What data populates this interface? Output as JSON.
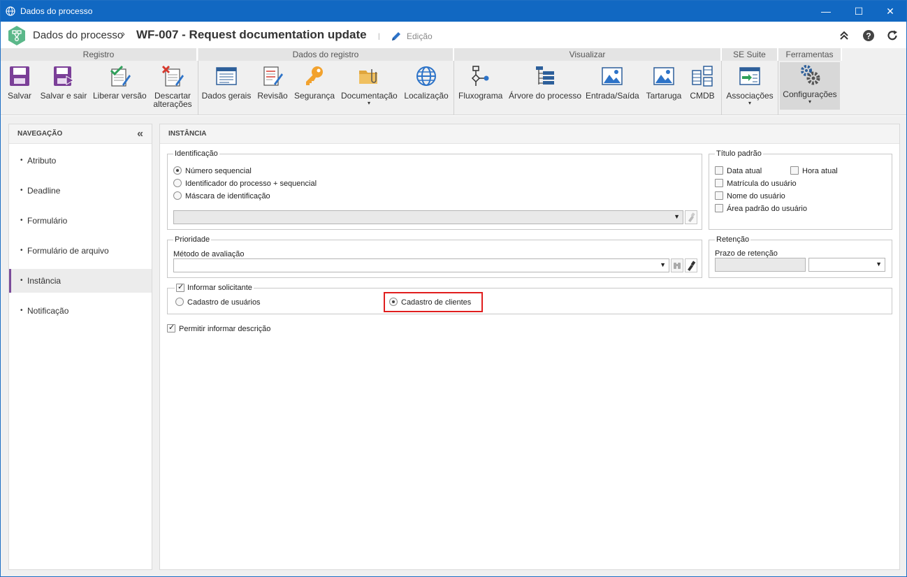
{
  "window": {
    "title": "Dados do processo",
    "minimize": "—",
    "maximize": "☐",
    "close": "✕"
  },
  "header": {
    "breadcrumb_root": "Dados do processo",
    "separator": "›",
    "breadcrumb_current": "WF-007 - Request documentation update",
    "divider": "|",
    "mode_label": "Edição"
  },
  "ribbon": {
    "groups": [
      {
        "title": "Registro",
        "buttons": [
          {
            "label": "Salvar",
            "icon": "save-icon"
          },
          {
            "label": "Salvar e sair",
            "icon": "save-exit-icon"
          },
          {
            "label": "Liberar versão",
            "icon": "release-version-icon"
          },
          {
            "label": "Descartar alterações",
            "label_line1": "Descartar",
            "label_line2": "alterações",
            "icon": "discard-changes-icon"
          }
        ]
      },
      {
        "title": "Dados do registro",
        "buttons": [
          {
            "label": "Dados gerais",
            "icon": "general-data-icon"
          },
          {
            "label": "Revisão",
            "icon": "revision-icon"
          },
          {
            "label": "Segurança",
            "icon": "key-icon"
          },
          {
            "label": "Documentação",
            "icon": "folder-attachment-icon",
            "dropdown": true
          },
          {
            "label": "Localização",
            "icon": "globe-icon"
          }
        ]
      },
      {
        "title": "Visualizar",
        "buttons": [
          {
            "label": "Fluxograma",
            "icon": "flowchart-icon"
          },
          {
            "label": "Árvore do processo",
            "icon": "process-tree-icon"
          },
          {
            "label": "Entrada/Saída",
            "icon": "input-output-icon"
          },
          {
            "label": "Tartaruga",
            "icon": "turtle-diagram-icon"
          },
          {
            "label": "CMDB",
            "icon": "cmdb-icon"
          }
        ]
      },
      {
        "title": "SE Suite",
        "buttons": [
          {
            "label": "Associações",
            "icon": "associations-icon",
            "dropdown": true
          }
        ]
      },
      {
        "title": "Ferramentas",
        "buttons": [
          {
            "label": "Configurações",
            "icon": "gears-icon",
            "dropdown": true
          }
        ]
      }
    ],
    "caret": "▾"
  },
  "nav": {
    "title": "NAVEGAÇÃO",
    "collapse": "«",
    "bullet": "•",
    "items": [
      "Atributo",
      "Deadline",
      "Formulário",
      "Formulário de arquivo",
      "Instância",
      "Notificação"
    ],
    "active_item": "Instância"
  },
  "content": {
    "title": "INSTÂNCIA",
    "identificacao": {
      "legend": "Identificação",
      "options": [
        "Número sequencial",
        "Identificador do processo + sequencial",
        "Máscara de identificação"
      ],
      "selected": "Número sequencial",
      "mask_value": ""
    },
    "titulo_padrao": {
      "legend": "Título padrão",
      "options": [
        "Data atual",
        "Hora atual",
        "Matrícula do usuário",
        "Nome do usuário",
        "Área padrão do usuário"
      ],
      "checked": []
    },
    "prioridade": {
      "legend": "Prioridade",
      "field_label": "Método de avaliação",
      "value": ""
    },
    "retencao": {
      "legend": "Retenção",
      "field_label": "Prazo de retenção",
      "value": "",
      "unit": ""
    },
    "solicitante": {
      "legend": "Informar solicitante",
      "checked": true,
      "options": [
        "Cadastro de usuários",
        "Cadastro de clientes"
      ],
      "selected": "Cadastro de clientes",
      "highlighted": "Cadastro de clientes"
    },
    "permitir_descricao": {
      "label": "Permitir informar descrição",
      "checked": true
    }
  },
  "colors": {
    "titlebar": "#1168c2",
    "accent_nav": "#7b4c9a",
    "highlight_box": "#e01e1e",
    "logo_green": "#5bb88a"
  }
}
